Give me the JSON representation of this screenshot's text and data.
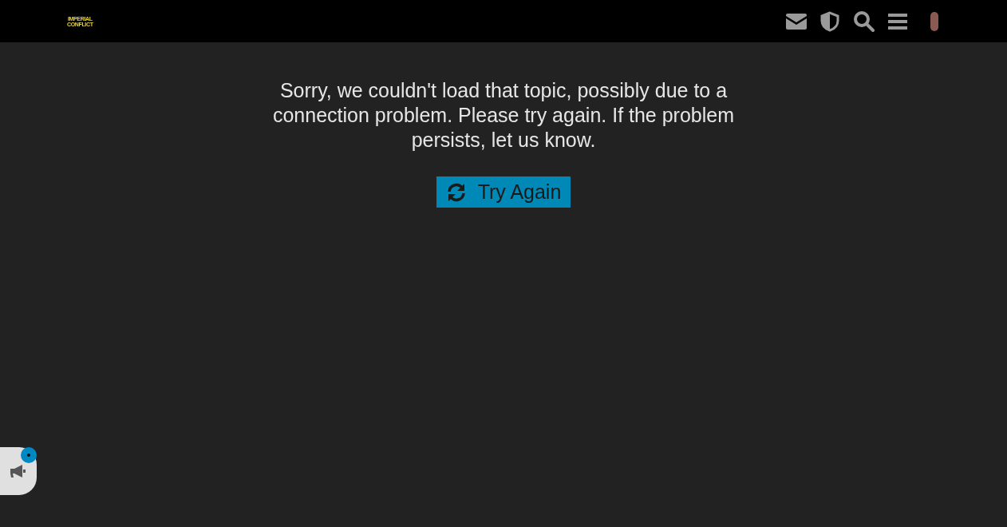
{
  "header": {
    "logo_lines": [
      "IMPERIAL",
      "CONFLICT"
    ]
  },
  "error": {
    "message": "Sorry, we couldn't load that topic, possibly due to a connection problem. Please try again. If the problem persists, let us know.",
    "button": "Try Again"
  }
}
